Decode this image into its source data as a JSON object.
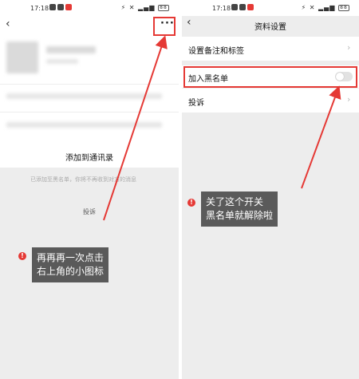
{
  "left": {
    "status": {
      "time": "17:18",
      "battery": "88"
    },
    "add_contact": "添加到通讯录",
    "blocked_notice": "已添加至黑名单，你将不再收到对方的消息",
    "report": "投诉",
    "annotation": {
      "badge": "!",
      "lines": [
        "再再再一次点击",
        "右上角的小图标"
      ]
    }
  },
  "right": {
    "status": {
      "time": "17:18",
      "battery": "88"
    },
    "title": "资料设置",
    "rows": [
      {
        "label": "设置备注和标签"
      },
      {
        "label": "加入黑名单",
        "toggle_on": false
      },
      {
        "label": "投诉"
      }
    ],
    "annotation": {
      "badge": "!",
      "lines": [
        "关了这个开关",
        "黑名单就解除啦"
      ]
    }
  },
  "colors": {
    "accent": "#e53935",
    "note_bg": "#5a5a5a",
    "page_bg": "#ededed"
  },
  "icons": [
    "back-arrow-icon",
    "more-dots-icon",
    "chevron-right-icon",
    "toggle-switch",
    "exclamation-icon"
  ]
}
